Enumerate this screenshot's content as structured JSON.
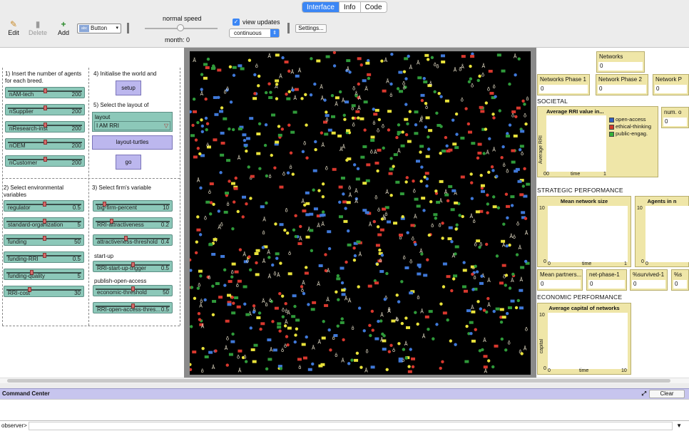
{
  "tabs": [
    "Interface",
    "Info",
    "Code"
  ],
  "toolbar": {
    "edit": "Edit",
    "delete": "Delete",
    "add": "Add",
    "widget_type": "Button",
    "speed_label": "normal speed",
    "month_label": "month: 0",
    "view_updates_label": "view updates",
    "update_mode": "continuous",
    "settings": "Settings..."
  },
  "sections": {
    "s1": "1) Insert the number of agents for each breed.",
    "s2": "2) Select environmental variables",
    "s3": "3) Select firm's variable",
    "s4": "4) Initialise the world and",
    "s5": "5) Select the layout of"
  },
  "breed_sliders": [
    {
      "label": "nAM-tech",
      "value": "200",
      "level": 0.5
    },
    {
      "label": "nSupplier",
      "value": "200",
      "level": 0.5
    },
    {
      "label": "nResearch-inst",
      "value": "200",
      "level": 0.5
    },
    {
      "label": "nOEM",
      "value": "200",
      "level": 0.5
    },
    {
      "label": "nCustomer",
      "value": "200",
      "level": 0.5
    }
  ],
  "env_sliders": [
    {
      "label": "regulator",
      "value": "0.5",
      "level": 0.5
    },
    {
      "label": "standard-organization",
      "value": "5",
      "level": 0.5
    },
    {
      "label": "funding",
      "value": "50",
      "level": 0.5
    },
    {
      "label": "funding-RRI",
      "value": "0.5",
      "level": 0.5
    },
    {
      "label": "funding-quality",
      "value": "5",
      "level": 0.33
    },
    {
      "label": "RRI-cost",
      "value": "30",
      "level": 0.3
    }
  ],
  "firm_sliders": [
    {
      "label": "big-firm-percent",
      "value": "10",
      "level": 0.1
    },
    {
      "label": "RRI-attractiveness",
      "value": "0.2",
      "level": 0.2
    },
    {
      "label": "attractiveness-threshold",
      "value": "0.4",
      "level": 0.4
    },
    {
      "label": "RRI-start-up-trigger",
      "value": "0.5",
      "level": 0.5
    },
    {
      "label": "economic-threshold",
      "value": "50",
      "level": 0.5
    },
    {
      "label": "RRI-open-access-thres...",
      "value": "0.5",
      "level": 0.5
    }
  ],
  "labels": {
    "startup": "start-up",
    "publish": "publish-open-access"
  },
  "buttons": {
    "setup": "setup",
    "layout": "layout-turtles",
    "go": "go"
  },
  "layout_chooser": {
    "label": "layout",
    "value": "I AM RRI"
  },
  "monitors": {
    "networks": {
      "label": "Networks",
      "value": "0"
    },
    "phase1": {
      "label": "Networks Phase 1",
      "value": "0"
    },
    "phase2": {
      "label": "Network Phase 2",
      "value": "0"
    },
    "phase3": {
      "label": "Network P",
      "value": "0"
    },
    "num_o": {
      "label": "num. o",
      "value": "0"
    },
    "mean_partners": {
      "label": "Mean partners...",
      "value": "0"
    },
    "net_phase1": {
      "label": "net-phase-1",
      "value": "0"
    },
    "survived1": {
      "label": "%survived-1",
      "value": "0"
    },
    "pct": {
      "label": "%s",
      "value": "0"
    }
  },
  "right_sections": {
    "societal": "SOCIETAL",
    "strategic": "STRATEGIC PERFORMANCE",
    "economic": "ECONOMIC PERFORMANCE"
  },
  "plots": {
    "rri": {
      "title": "Average RRI value in...",
      "ylabel": "Average RRI",
      "xlabel": "time",
      "xmin": "0",
      "xmax": "1",
      "ymin": "0",
      "legend": [
        {
          "name": "open-access",
          "color": "#2f5fc4"
        },
        {
          "name": "ethical-thinking",
          "color": "#d23a2a"
        },
        {
          "name": "public-engag.",
          "color": "#33b13a"
        }
      ]
    },
    "network_size": {
      "title": "Mean network size",
      "xlabel": "time",
      "ymax": "10",
      "ymin": "0",
      "xmin": "0",
      "xmax": "1"
    },
    "agents_in": {
      "title": "Agents in n",
      "ymax": "10",
      "ymin": "0",
      "xmin": "0"
    },
    "capital": {
      "title": "Average capital of networks",
      "ylabel": "capital",
      "xlabel": "time",
      "ymax": "10",
      "ymin": "0",
      "xmin": "0",
      "xmax": "10"
    }
  },
  "command_center": {
    "title": "Command Center",
    "clear": "Clear",
    "prompt": "observer>"
  },
  "colors": {
    "turtle_colors": [
      "#3f78d8",
      "#d8382e",
      "#e8e23a",
      "#2f9a3a",
      "#f0e8d0"
    ]
  }
}
